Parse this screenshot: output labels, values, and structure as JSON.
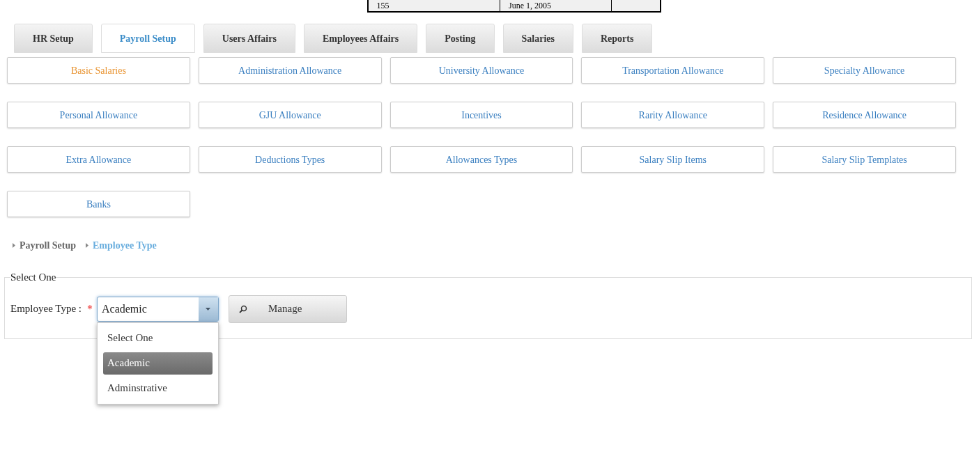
{
  "header_table": {
    "cells": [
      "155",
      "June 1, 2005",
      ""
    ]
  },
  "tabs": [
    {
      "label": "HR Setup",
      "selected": false
    },
    {
      "label": "Payroll Setup",
      "selected": true
    },
    {
      "label": "Users Affairs",
      "selected": false
    },
    {
      "label": "Employees Affairs",
      "selected": false
    },
    {
      "label": "Posting",
      "selected": false
    },
    {
      "label": "Salaries",
      "selected": false
    },
    {
      "label": "Reports",
      "selected": false
    }
  ],
  "menu_buttons": [
    {
      "label": "Basic Salaries",
      "selected": true
    },
    {
      "label": "Administration Allowance",
      "selected": false
    },
    {
      "label": "University Allowance",
      "selected": false
    },
    {
      "label": "Transportation Allowance",
      "selected": false
    },
    {
      "label": "Specialty Allowance",
      "selected": false
    },
    {
      "label": "Personal Allowance",
      "selected": false
    },
    {
      "label": "GJU Allowance",
      "selected": false
    },
    {
      "label": "Incentives",
      "selected": false
    },
    {
      "label": "Rarity Allowance",
      "selected": false
    },
    {
      "label": "Residence Allowance",
      "selected": false
    },
    {
      "label": "Extra Allowance",
      "selected": false
    },
    {
      "label": "Deductions Types",
      "selected": false
    },
    {
      "label": "Allowances Types",
      "selected": false
    },
    {
      "label": "Salary Slip Items",
      "selected": false
    },
    {
      "label": "Salary Slip Templates",
      "selected": false
    },
    {
      "label": "Banks",
      "selected": false
    }
  ],
  "breadcrumb": [
    {
      "label": "Payroll Setup",
      "selected": false
    },
    {
      "label": "Employee Type",
      "selected": true
    }
  ],
  "fieldset": {
    "legend": "Select One",
    "field_label": "Employee Type :",
    "required_mark": "*",
    "value": "Academic",
    "manage_button": "Manage",
    "dropdown": {
      "expanded": true,
      "options": [
        {
          "label": "Select One",
          "selected": false
        },
        {
          "label": "Academic",
          "selected": true
        },
        {
          "label": "Adminstrative",
          "selected": false
        }
      ]
    }
  }
}
